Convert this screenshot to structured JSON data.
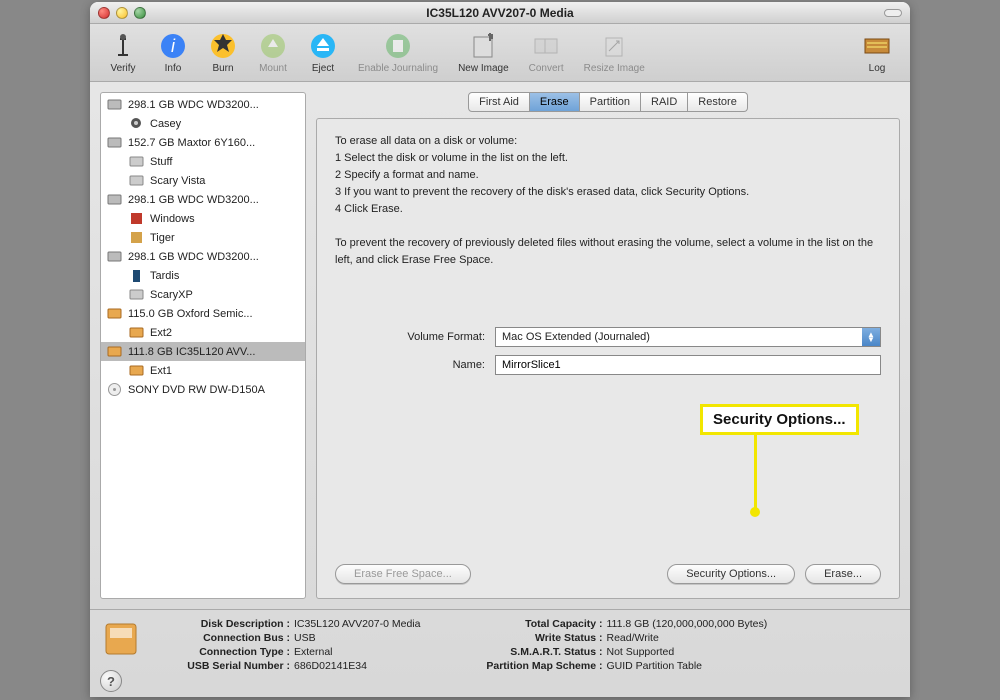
{
  "window_title": "IC35L120 AVV207-0 Media",
  "toolbar": [
    {
      "label": "Verify",
      "dim": false,
      "icon": "microscope"
    },
    {
      "label": "Info",
      "dim": false,
      "icon": "info"
    },
    {
      "label": "Burn",
      "dim": false,
      "icon": "burn"
    },
    {
      "label": "Mount",
      "dim": true,
      "icon": "mount"
    },
    {
      "label": "Eject",
      "dim": false,
      "icon": "eject"
    },
    {
      "label": "Enable Journaling",
      "dim": true,
      "icon": "journal"
    },
    {
      "label": "New Image",
      "dim": false,
      "icon": "newimage"
    },
    {
      "label": "Convert",
      "dim": true,
      "icon": "convert"
    },
    {
      "label": "Resize Image",
      "dim": true,
      "icon": "resize"
    }
  ],
  "toolbar_right": {
    "label": "Log",
    "icon": "log"
  },
  "sidebar": [
    {
      "type": "disk",
      "label": "298.1 GB WDC WD3200...",
      "icon": "hdd"
    },
    {
      "type": "vol",
      "label": "Casey",
      "icon": "gear"
    },
    {
      "type": "disk",
      "label": "152.7 GB Maxtor 6Y160...",
      "icon": "hdd"
    },
    {
      "type": "vol",
      "label": "Stuff",
      "icon": "hdd-sm"
    },
    {
      "type": "vol",
      "label": "Scary Vista",
      "icon": "hdd-sm"
    },
    {
      "type": "disk",
      "label": "298.1 GB WDC WD3200...",
      "icon": "hdd"
    },
    {
      "type": "vol",
      "label": "Windows",
      "icon": "win"
    },
    {
      "type": "vol",
      "label": "Tiger",
      "icon": "tiger"
    },
    {
      "type": "disk",
      "label": "298.1 GB WDC WD3200...",
      "icon": "hdd"
    },
    {
      "type": "vol",
      "label": "Tardis",
      "icon": "tardis"
    },
    {
      "type": "vol",
      "label": "ScaryXP",
      "icon": "hdd-sm"
    },
    {
      "type": "disk",
      "label": "115.0 GB Oxford Semic...",
      "icon": "ext"
    },
    {
      "type": "vol",
      "label": "Ext2",
      "icon": "ext-sm"
    },
    {
      "type": "disk",
      "label": "111.8 GB IC35L120 AVV...",
      "icon": "ext",
      "selected": true
    },
    {
      "type": "vol",
      "label": "Ext1",
      "icon": "ext-sm"
    },
    {
      "type": "disk",
      "label": "SONY DVD RW DW-D150A",
      "icon": "optical"
    }
  ],
  "tabs": [
    "First Aid",
    "Erase",
    "Partition",
    "RAID",
    "Restore"
  ],
  "active_tab": "Erase",
  "instructions": {
    "intro": "To erase all data on a disk or volume:",
    "steps": [
      "1 Select the disk or volume in the list on the left.",
      "2 Specify a format and name.",
      "3 If you want to prevent the recovery of the disk's erased data, click Security Options.",
      "4 Click Erase."
    ],
    "note": "To prevent the recovery of previously deleted files without erasing the volume, select a volume in the list on the left, and click Erase Free Space."
  },
  "form": {
    "volume_format_label": "Volume Format:",
    "volume_format_value": "Mac OS Extended (Journaled)",
    "name_label": "Name:",
    "name_value": "MirrorSlice1"
  },
  "buttons": {
    "erase_free_space": "Erase Free Space...",
    "security_options": "Security Options...",
    "erase": "Erase..."
  },
  "footer": {
    "left": [
      {
        "k": "Disk Description :",
        "v": "IC35L120 AVV207-0 Media"
      },
      {
        "k": "Connection Bus :",
        "v": "USB"
      },
      {
        "k": "Connection Type :",
        "v": "External"
      },
      {
        "k": "USB Serial Number :",
        "v": "686D02141E34"
      }
    ],
    "right": [
      {
        "k": "Total Capacity :",
        "v": "111.8 GB (120,000,000,000 Bytes)"
      },
      {
        "k": "Write Status :",
        "v": "Read/Write"
      },
      {
        "k": "S.M.A.R.T. Status :",
        "v": "Not Supported"
      },
      {
        "k": "Partition Map Scheme :",
        "v": "GUID Partition Table"
      }
    ]
  },
  "callout": {
    "label": "Security Options..."
  }
}
